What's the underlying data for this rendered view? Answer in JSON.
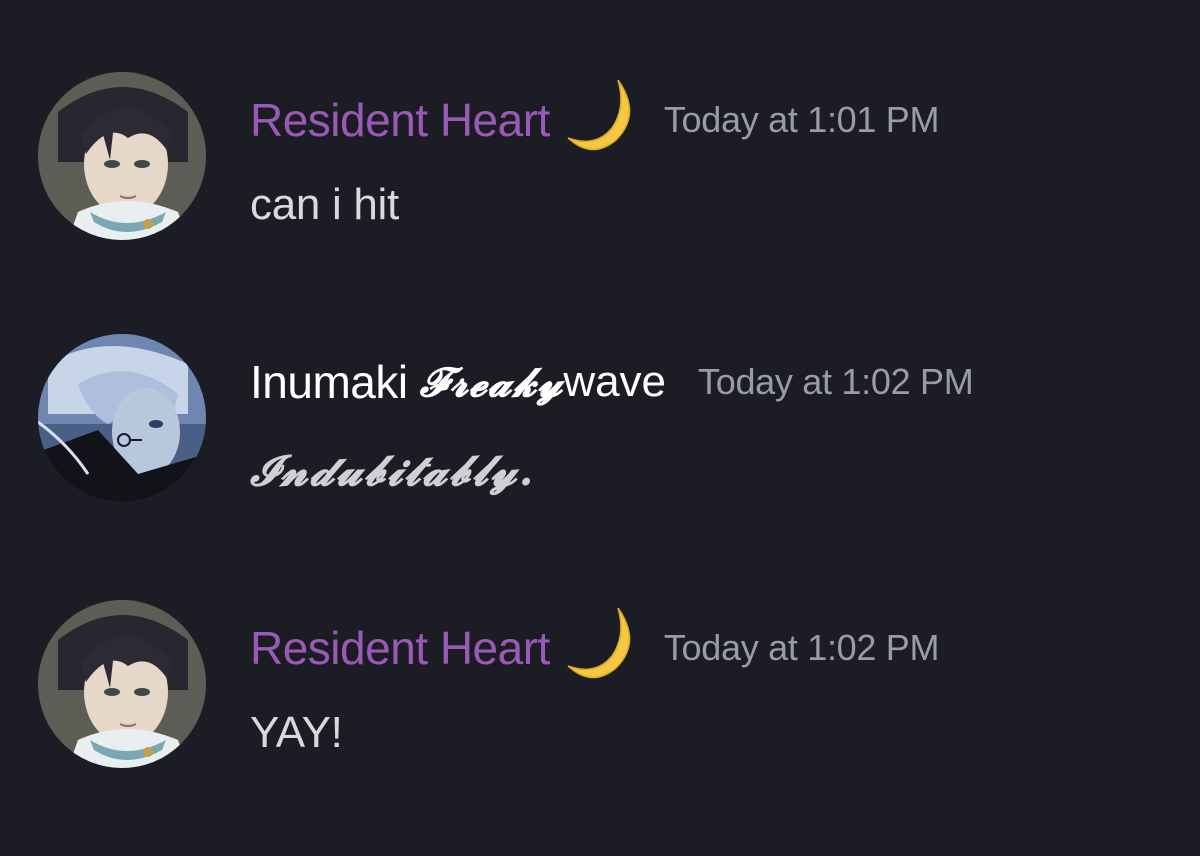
{
  "messages": [
    {
      "username": "Resident Heart",
      "username_color": "#9b59b6",
      "badge_icon": "crescent-moon-icon",
      "timestamp": "Today at 1:01 PM",
      "text": "can i hit",
      "avatar": "anime-character-avatar-dark-hair"
    },
    {
      "username": "Inumaki",
      "username_fancy": "𝓕𝓻𝓮𝓪𝓴𝔂",
      "username_suffix": "wave",
      "username_color": "#ffffff",
      "timestamp": "Today at 1:02 PM",
      "text": "𝓘𝓷𝓭𝓾𝓫𝓲𝓽𝓪𝓫𝓵𝔂.",
      "avatar": "anime-character-avatar-white-hair"
    },
    {
      "username": "Resident Heart",
      "username_color": "#9b59b6",
      "badge_icon": "crescent-moon-icon",
      "timestamp": "Today at 1:02 PM",
      "text": "YAY!",
      "avatar": "anime-character-avatar-dark-hair"
    }
  ],
  "colors": {
    "background": "#1c1d24",
    "timestamp": "#9a9ca3",
    "message_text": "#d8d9dd",
    "moon": "#f5c842"
  }
}
